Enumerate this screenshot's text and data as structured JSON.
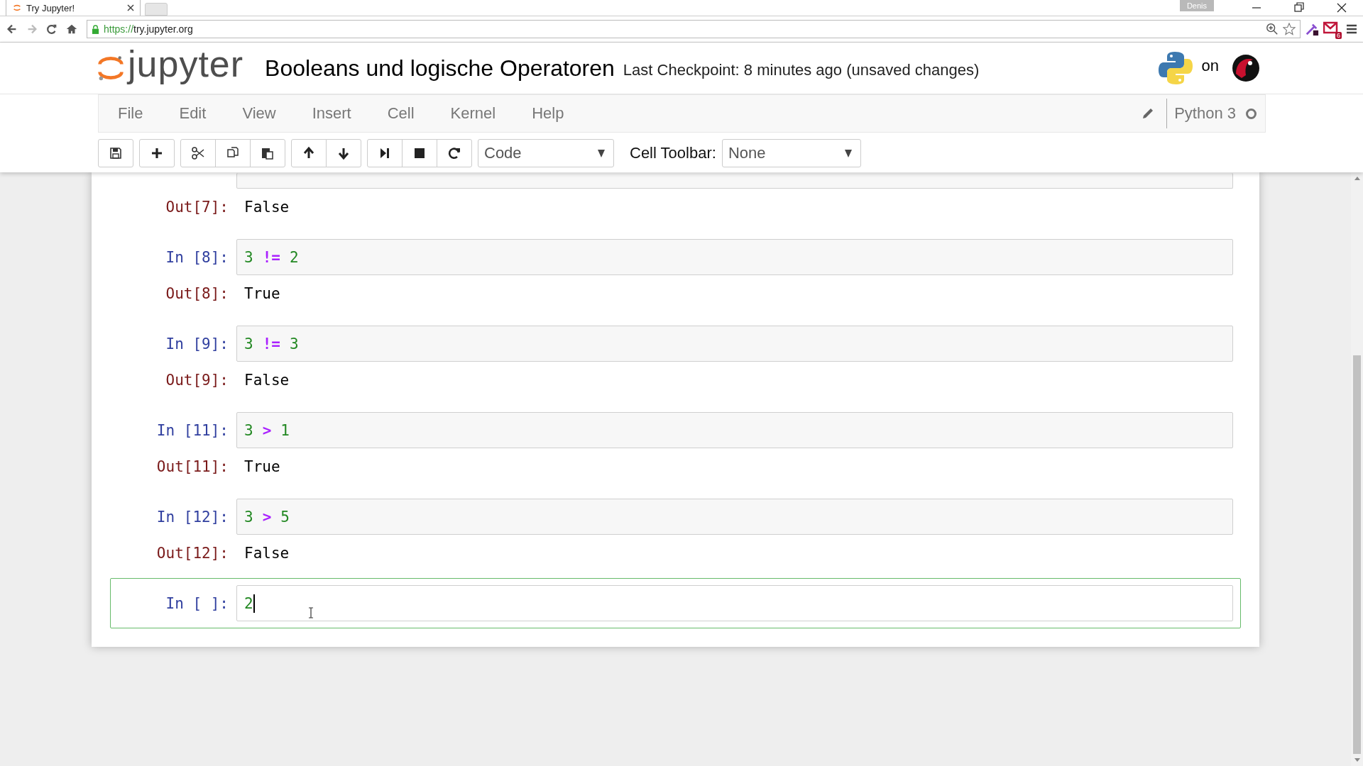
{
  "browser": {
    "tab_title": "Try Jupyter!",
    "url_scheme": "https://",
    "url_host": "try.jupyter.org",
    "profile": "Denis",
    "mail_badge": "6"
  },
  "header": {
    "logo": "jupyter",
    "title": "Booleans und logische Operatoren",
    "checkpoint": "Last Checkpoint: 8 minutes ago (unsaved changes)",
    "on": "on"
  },
  "menu": [
    {
      "label": "File"
    },
    {
      "label": "Edit"
    },
    {
      "label": "View"
    },
    {
      "label": "Insert"
    },
    {
      "label": "Cell"
    },
    {
      "label": "Kernel"
    },
    {
      "label": "Help"
    }
  ],
  "kernel": {
    "name": "Python 3",
    "busy": false
  },
  "toolbar": {
    "cell_type": "Code",
    "cell_toolbar_label": "Cell Toolbar:",
    "cell_toolbar": "None"
  },
  "cells": [
    {
      "input_cut": true,
      "out_prompt": "Out[7]:",
      "output": "False",
      "selected": false
    },
    {
      "in_prompt": "In [8]:",
      "code": [
        {
          "kind": "number",
          "text": "3"
        },
        {
          "kind": "operator",
          "text": "!="
        },
        {
          "kind": "number",
          "text": "2"
        }
      ],
      "out_prompt": "Out[8]:",
      "output": "True",
      "selected": false
    },
    {
      "in_prompt": "In [9]:",
      "code": [
        {
          "kind": "number",
          "text": "3"
        },
        {
          "kind": "operator",
          "text": "!="
        },
        {
          "kind": "number",
          "text": "3"
        }
      ],
      "out_prompt": "Out[9]:",
      "output": "False",
      "selected": false
    },
    {
      "in_prompt": "In [11]:",
      "code": [
        {
          "kind": "number",
          "text": "3"
        },
        {
          "kind": "operator",
          "text": ">"
        },
        {
          "kind": "number",
          "text": "1"
        }
      ],
      "out_prompt": "Out[11]:",
      "output": "True",
      "selected": false
    },
    {
      "in_prompt": "In [12]:",
      "code": [
        {
          "kind": "number",
          "text": "3"
        },
        {
          "kind": "operator",
          "text": ">"
        },
        {
          "kind": "number",
          "text": "5"
        }
      ],
      "out_prompt": "Out[12]:",
      "output": "False",
      "selected": false
    },
    {
      "in_prompt": "In [ ]:",
      "code": [
        {
          "kind": "number",
          "text": "2"
        }
      ],
      "selected": true
    }
  ]
}
